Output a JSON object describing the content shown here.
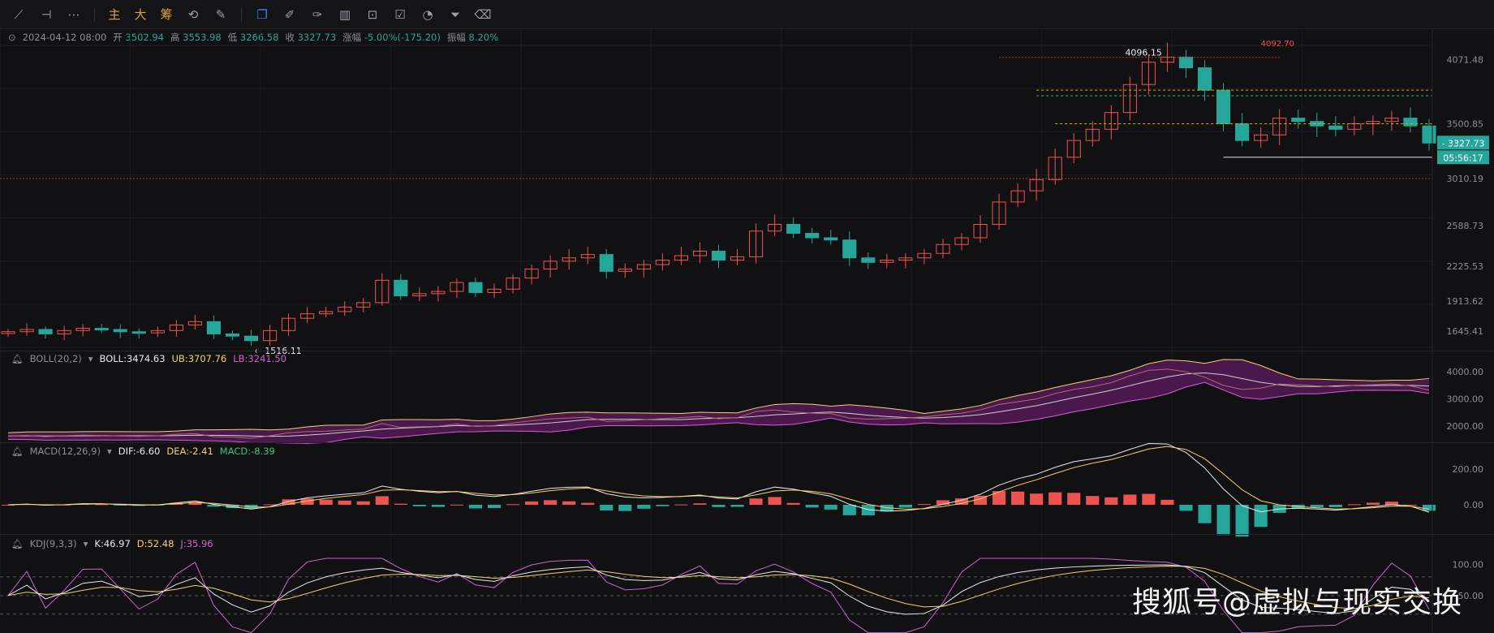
{
  "toolbar": {
    "buttons": [
      "trendline-icon",
      "horizontal-line-icon",
      "more-dots-icon",
      "主",
      "大",
      "筹",
      "replay-icon",
      "magic-icon",
      "copy-icon",
      "ruler-icon",
      "draw-icon",
      "bars-icon",
      "lock-icon",
      "note-icon",
      "palette-icon",
      "filter-icon",
      "trash-icon"
    ]
  },
  "ohlc": {
    "datetime": "2024-04-12 08:00",
    "open_label": "开",
    "open": "3502.94",
    "high_label": "高",
    "high": "3553.98",
    "low_label": "低",
    "low": "3266.58",
    "close_label": "收",
    "close": "3327.73",
    "change_label": "涨幅",
    "change": "-5.00%(-175.20)",
    "amp_label": "振幅",
    "amp": "8.20%"
  },
  "boll": {
    "name": "BOLL(20,2)",
    "mid": "BOLL:3474.63",
    "ub": "UB:3707.76",
    "lb": "LB:3241.50"
  },
  "macd": {
    "name": "MACD(12,26,9)",
    "dif": "DIF:-6.60",
    "dea": "DEA:-2.41",
    "macd": "MACD:-8.39"
  },
  "kdj": {
    "name": "KDJ(9,3,3)",
    "k": "K:46.97",
    "d": "D:52.48",
    "j": "J:35.96"
  },
  "price_axis": [
    "4071.48",
    "3500.85",
    "3010.19",
    "2588.73",
    "2225.53",
    "1913.62",
    "1645.41"
  ],
  "boll_axis": [
    "4000.00",
    "3000.00",
    "2000.00"
  ],
  "macd_axis": [
    "200.00",
    "0.00"
  ],
  "kdj_axis": [
    "100.00",
    "50.00"
  ],
  "badges": {
    "last_price": "3327.73",
    "countdown": "05:56:17"
  },
  "annotations": {
    "high": "4096.15",
    "low": "1516.11",
    "red_level": "4092.70"
  },
  "watermark": "搜狐号@虚拟与现实交换",
  "colors": {
    "up": "#ef5350",
    "down": "#26a69a",
    "bg": "#111113",
    "boll_fill": "#5a1a5c",
    "dif": "#e7e9ee",
    "dea": "#f3d36b"
  },
  "chart_data": {
    "type": "line",
    "title": "",
    "series": [
      {
        "name": "BOLL:3474.63",
        "values": [
          1640,
          1660,
          1620,
          1650,
          1670,
          1660,
          1640,
          1630,
          1650,
          1700,
          1730,
          1620,
          1600,
          1560,
          1650,
          1760,
          1800,
          1820,
          1860,
          1900,
          2100,
          1960,
          1980,
          2000,
          2080,
          1990,
          2020,
          2120,
          2200,
          2270,
          2300,
          2330,
          2180,
          2200,
          2240,
          2280,
          2320,
          2360,
          2280,
          2310,
          2540,
          2600,
          2520,
          2480,
          2460,
          2300,
          2260,
          2280,
          2300,
          2340,
          2420,
          2480,
          2600,
          2800,
          2900,
          3000,
          3200,
          3350,
          3450,
          3600,
          3850,
          4050,
          4096,
          4000,
          3800,
          3500,
          3350,
          3400,
          3550,
          3520,
          3480,
          3450,
          3500,
          3520,
          3550,
          3480,
          3327
        ]
      }
    ],
    "ylim": [
      1500,
      4200
    ],
    "annotations": [
      "4096.15",
      "1516.11",
      "4092.70"
    ]
  }
}
